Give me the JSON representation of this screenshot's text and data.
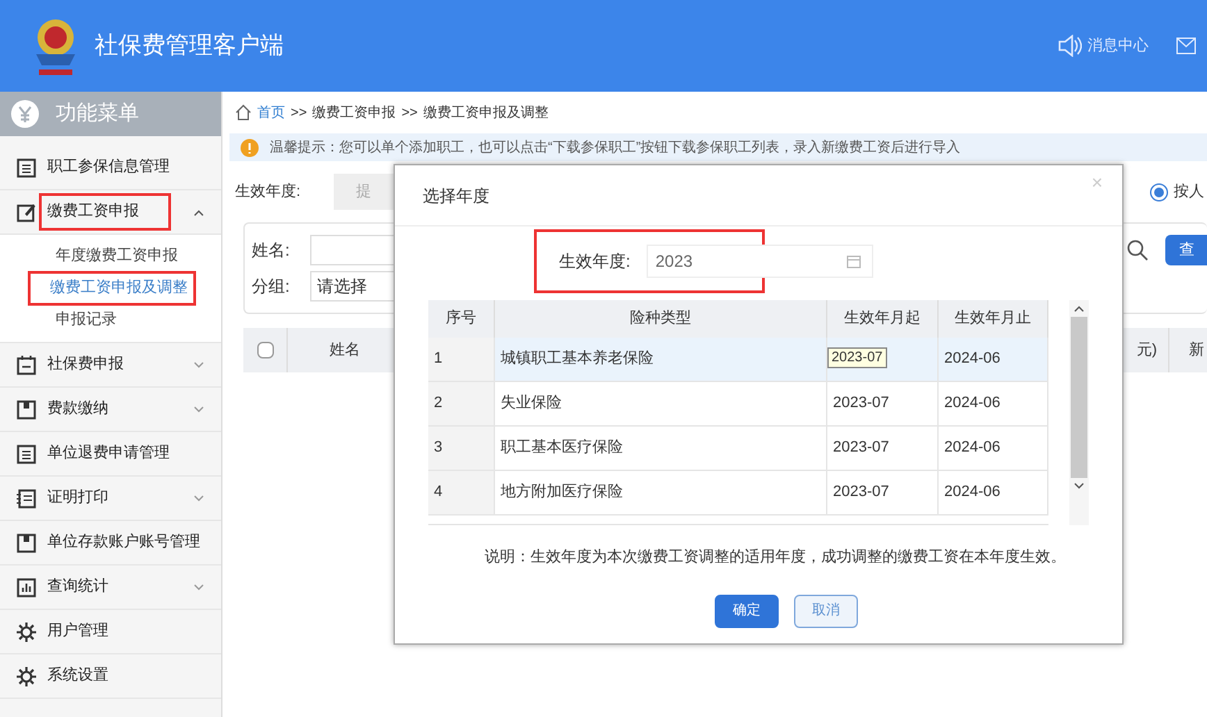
{
  "header": {
    "title": "社保费管理客户端",
    "messages": "消息中心"
  },
  "sidebar": {
    "title": "功能菜单",
    "items": [
      {
        "label": "职工参保信息管理"
      },
      {
        "label": "缴费工资申报",
        "highlighted": true,
        "expanded": true,
        "children": [
          {
            "label": "年度缴费工资申报",
            "selected": false
          },
          {
            "label": "缴费工资申报及调整",
            "selected": true,
            "highlighted": true
          },
          {
            "label": "申报记录",
            "selected": false
          }
        ]
      },
      {
        "label": "社保费申报",
        "expanded": false
      },
      {
        "label": "费款缴纳",
        "expanded": false
      },
      {
        "label": "单位退费申请管理"
      },
      {
        "label": "证明打印",
        "expanded": false
      },
      {
        "label": "单位存款账户账号管理"
      },
      {
        "label": "查询统计",
        "expanded": false
      },
      {
        "label": "用户管理"
      },
      {
        "label": "系统设置"
      }
    ]
  },
  "breadcrumb": {
    "separator": ">>",
    "items": [
      "首页",
      "缴费工资申报",
      "缴费工资申报及调整"
    ]
  },
  "tip": "温馨提示：您可以单个添加职工，也可以点击“下载参保职工”按钮下载参保职工列表，录入新缴费工资后进行导入",
  "toolbar": {
    "year_label": "生效年度:",
    "submit": "提",
    "radio": {
      "label": "按人",
      "selected": true
    }
  },
  "filters": {
    "name_label": "姓名:",
    "group_label": "分组:",
    "group_value": "请选择",
    "query": "查"
  },
  "table": {
    "checked": false,
    "columns": [
      "姓名",
      "元)",
      "新"
    ]
  },
  "dialog": {
    "title": "选择年度",
    "close": "×",
    "year_label": "生效年度:",
    "year_value": "2023",
    "year_highlighted": true,
    "columns": [
      "序号",
      "险种类型",
      "生效年月起",
      "生效年月止"
    ],
    "rows": [
      {
        "no": "1",
        "type": "城镇职工基本养老保险",
        "end": "2024-06",
        "selected": true
      },
      {
        "no": "2",
        "type": "失业保险",
        "start": "2023-07",
        "end": "2024-06",
        "selected": false
      },
      {
        "no": "3",
        "type": "职工基本医疗保险",
        "start": "2023-07",
        "end": "2024-06",
        "selected": false
      },
      {
        "no": "4",
        "type": "地方附加医疗保险",
        "start": "2023-07",
        "end": "2024-06",
        "selected": false
      }
    ],
    "tooltip": "2023-07",
    "note": "说明：生效年度为本次缴费工资调整的适用年度，成功调整的缴费工资在本年度生效。",
    "buttons": [
      {
        "label": "确定",
        "kind": "primary"
      },
      {
        "label": "取消",
        "kind": "secondary"
      }
    ]
  }
}
